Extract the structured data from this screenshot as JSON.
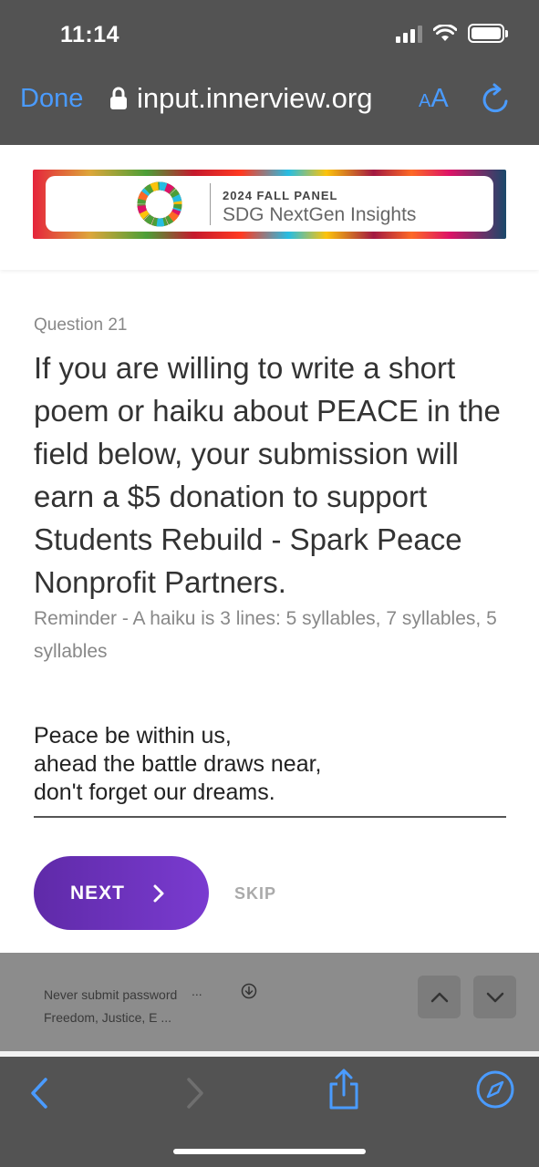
{
  "status_bar": {
    "time": "11:14"
  },
  "browser": {
    "done_label": "Done",
    "url": "input.innerview.org",
    "aa_label_small": "A",
    "aa_label_big": "A"
  },
  "banner": {
    "small_text": "2024 FALL PANEL",
    "big_text": "SDG NextGen Insights"
  },
  "question": {
    "number": "Question 21",
    "text": "If you are willing to write a short poem or haiku about PEACE in the field below, your submission will earn a $5 donation to support Students Rebuild - Spark Peace Nonprofit Partners.",
    "reminder": "Reminder - A haiku is 3 lines: 5 syllables, 7 syllables, 5 syllables",
    "answer": "Peace be within us,\nahead the battle draws near,\ndon't forget our dreams."
  },
  "actions": {
    "next_label": "NEXT",
    "skip_label": "SKIP"
  },
  "autofill": {
    "line1": "Never submit password",
    "line2": "Freedom, Justice, E ...",
    "ellipsis": "..."
  },
  "colors": {
    "accent_blue": "#4a9bff",
    "next_button": "#6a30bd",
    "chrome_gray": "#535353"
  },
  "icons": {
    "lock": "lock-icon",
    "reload": "reload-icon",
    "wifi": "wifi-icon",
    "battery": "battery-icon",
    "signal": "signal-icon",
    "next_chevron": "chevron-right-icon",
    "download": "download-circle-icon",
    "field_up": "chevron-up-icon",
    "field_down": "chevron-down-icon",
    "back": "back-arrow-icon",
    "forward": "forward-arrow-icon",
    "share": "share-icon",
    "compass": "compass-icon"
  }
}
